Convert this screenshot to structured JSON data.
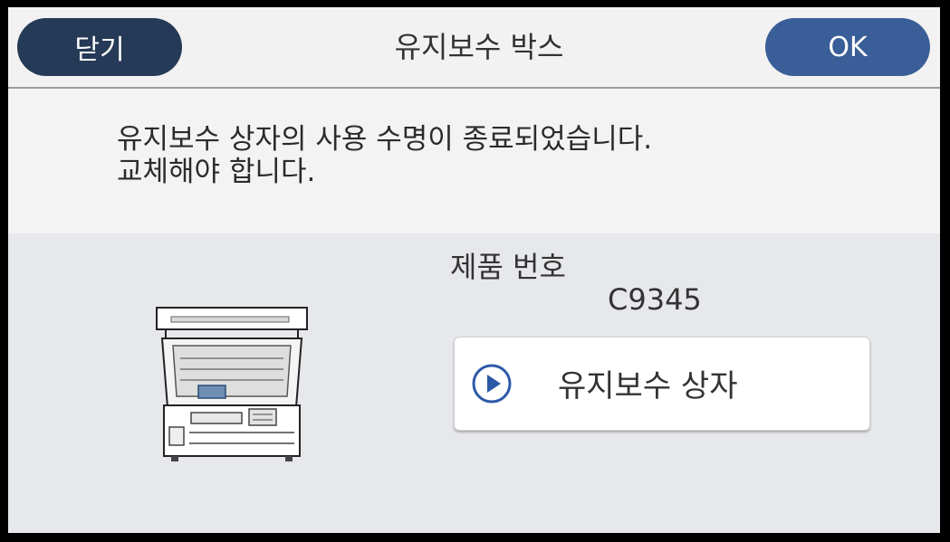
{
  "header": {
    "close_label": "닫기",
    "title": "유지보수 박스",
    "ok_label": "OK"
  },
  "message": {
    "line1": "유지보수 상자의 사용 수명이 종료되었습니다.",
    "line2": "교체해야 합니다."
  },
  "product": {
    "label": "제품 번호",
    "number": "C9345"
  },
  "part_button": {
    "icon": "play-circle-icon",
    "label": "유지보수 상자"
  },
  "colors": {
    "close_button": "#253a56",
    "ok_button": "#3a5e97",
    "play_icon": "#2d5aa8"
  }
}
